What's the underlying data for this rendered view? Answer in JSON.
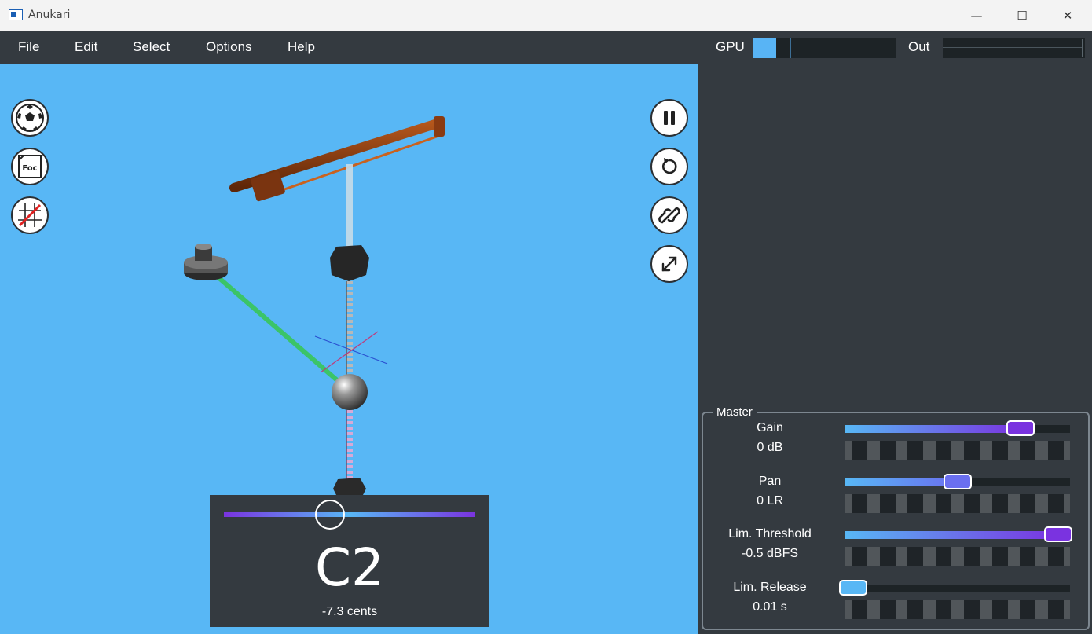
{
  "window": {
    "title": "Anukari",
    "min_glyph": "—",
    "max_glyph": "☐",
    "close_glyph": "✕"
  },
  "menu": {
    "items": [
      {
        "label": "File"
      },
      {
        "label": "Edit"
      },
      {
        "label": "Select"
      },
      {
        "label": "Options"
      },
      {
        "label": "Help"
      }
    ],
    "gpu_label": "GPU",
    "gpu_load_fraction": 0.16,
    "out_label": "Out"
  },
  "viewport": {
    "background": "#58b7f5",
    "left_tools": [
      "soccer-ball-icon",
      "focus-icon",
      "grid-off-icon"
    ],
    "focus_text": "Foc",
    "right_tools": [
      "pause-icon",
      "reset-icon",
      "link-icon",
      "expand-icon"
    ]
  },
  "tuner": {
    "note": "C2",
    "cents": "-7.3 cents",
    "accent_purple": "#7a33e0",
    "accent_blue": "#58b7f5"
  },
  "master": {
    "title": "Master",
    "params": [
      {
        "name": "Gain",
        "value": "0 dB",
        "position": 0.8
      },
      {
        "name": "Pan",
        "value": "0 LR",
        "position": 0.5
      },
      {
        "name": "Lim. Threshold",
        "value": "-0.5 dBFS",
        "position": 0.98
      },
      {
        "name": "Lim. Release",
        "value": "0.01 s",
        "position": 0.0
      }
    ]
  }
}
